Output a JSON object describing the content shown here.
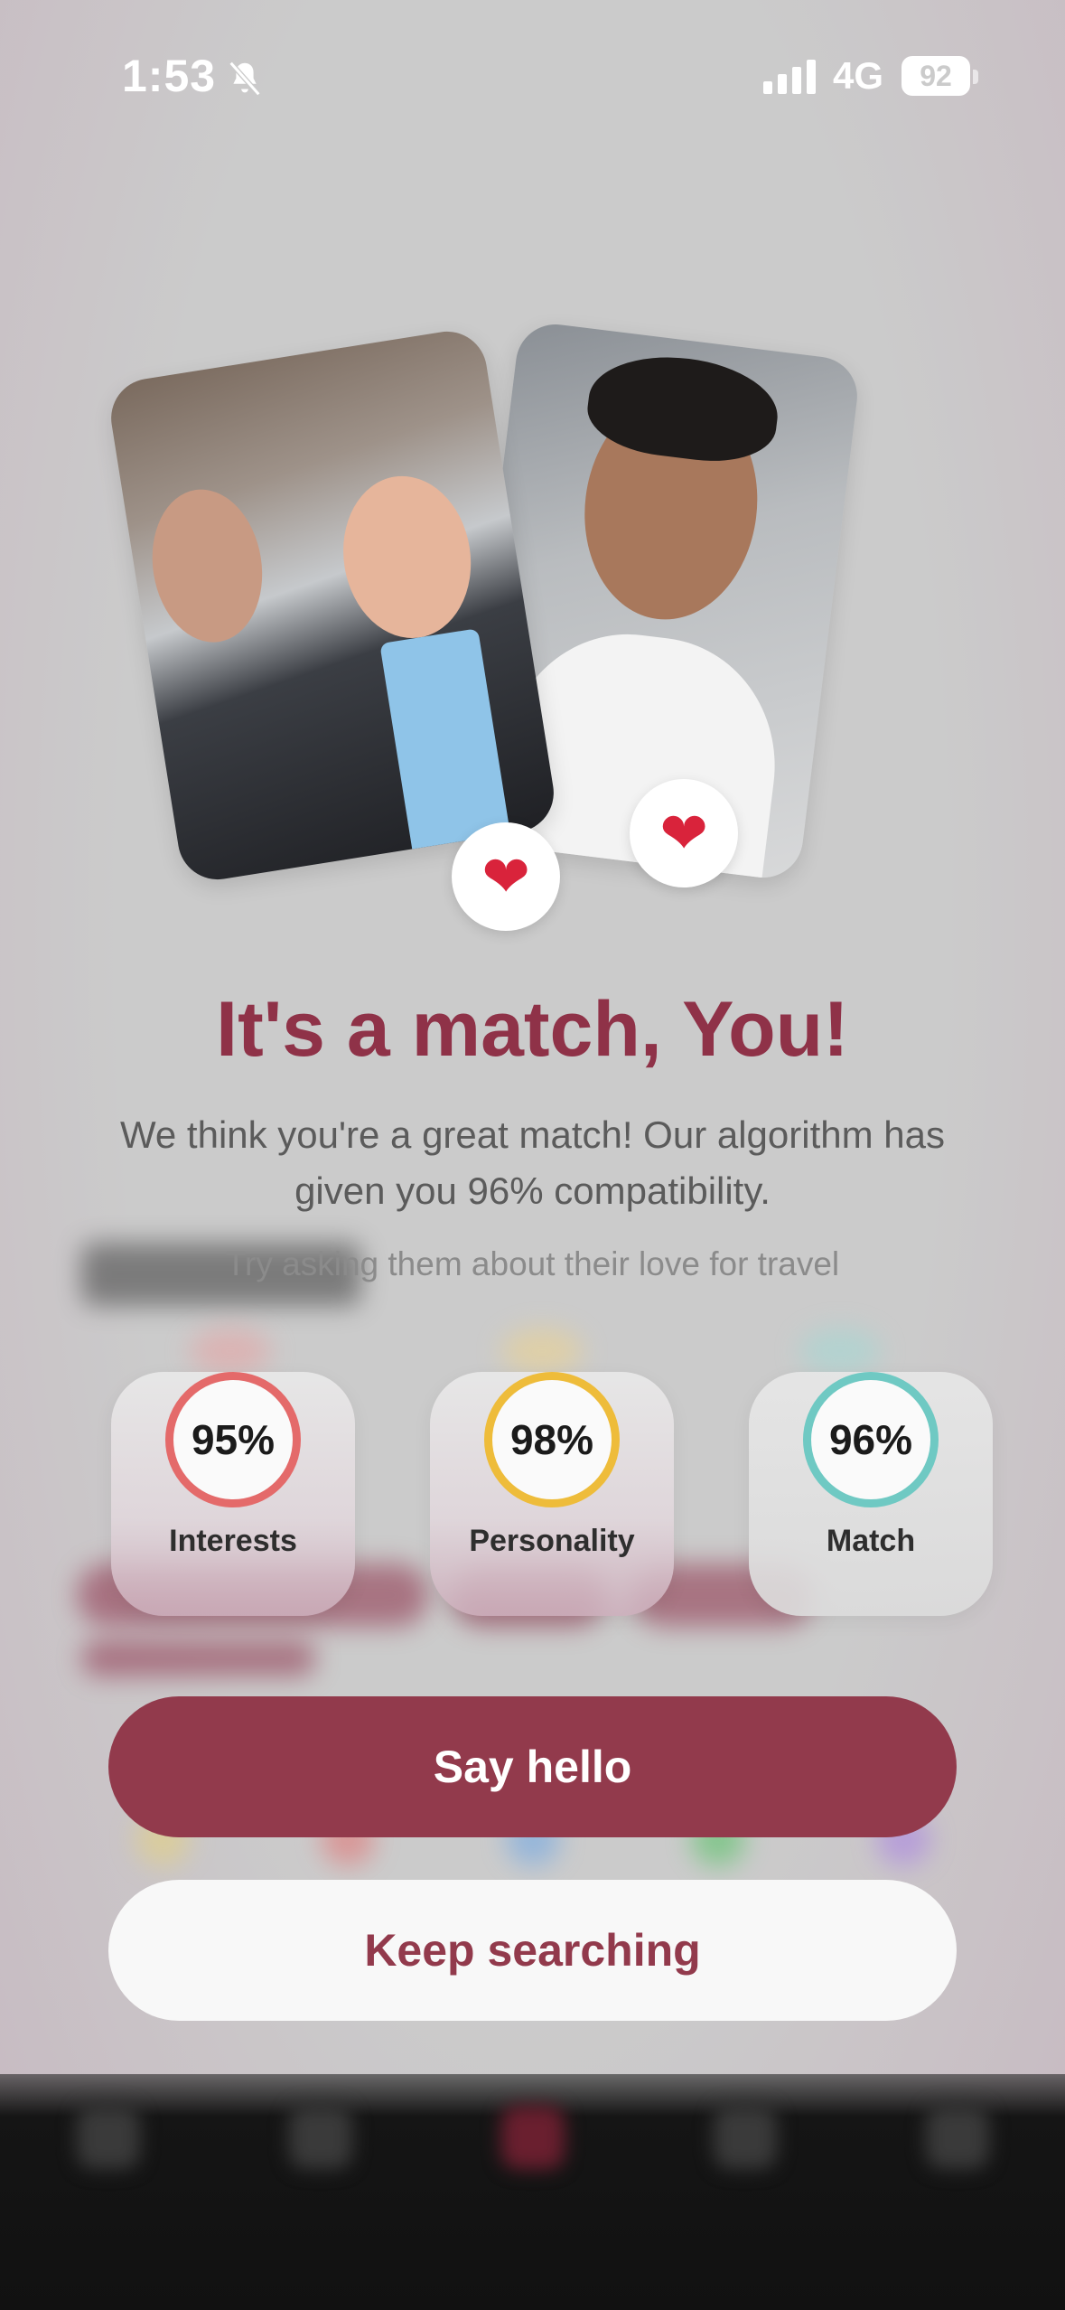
{
  "status_bar": {
    "time": "1:53",
    "network": "4G",
    "battery": "92"
  },
  "match": {
    "title": "It's a match, You!",
    "subtitle": "We think you're a great match! Our algorithm has given you 96% compatibility.",
    "hint": "Try asking them about their love for travel"
  },
  "scores": [
    {
      "value": "95%",
      "label": "Interests",
      "color": "#e46a6a"
    },
    {
      "value": "98%",
      "label": "Personality",
      "color": "#eebc3a"
    },
    {
      "value": "96%",
      "label": "Match",
      "color": "#6fc9c3"
    }
  ],
  "actions": {
    "primary": "Say hello",
    "secondary": "Keep searching"
  },
  "icons": {
    "heart": "❤",
    "bell_off": "bell-slash-icon",
    "signal": "signal-icon"
  },
  "colors": {
    "accent": "#923a4c",
    "title": "#8f3248"
  }
}
